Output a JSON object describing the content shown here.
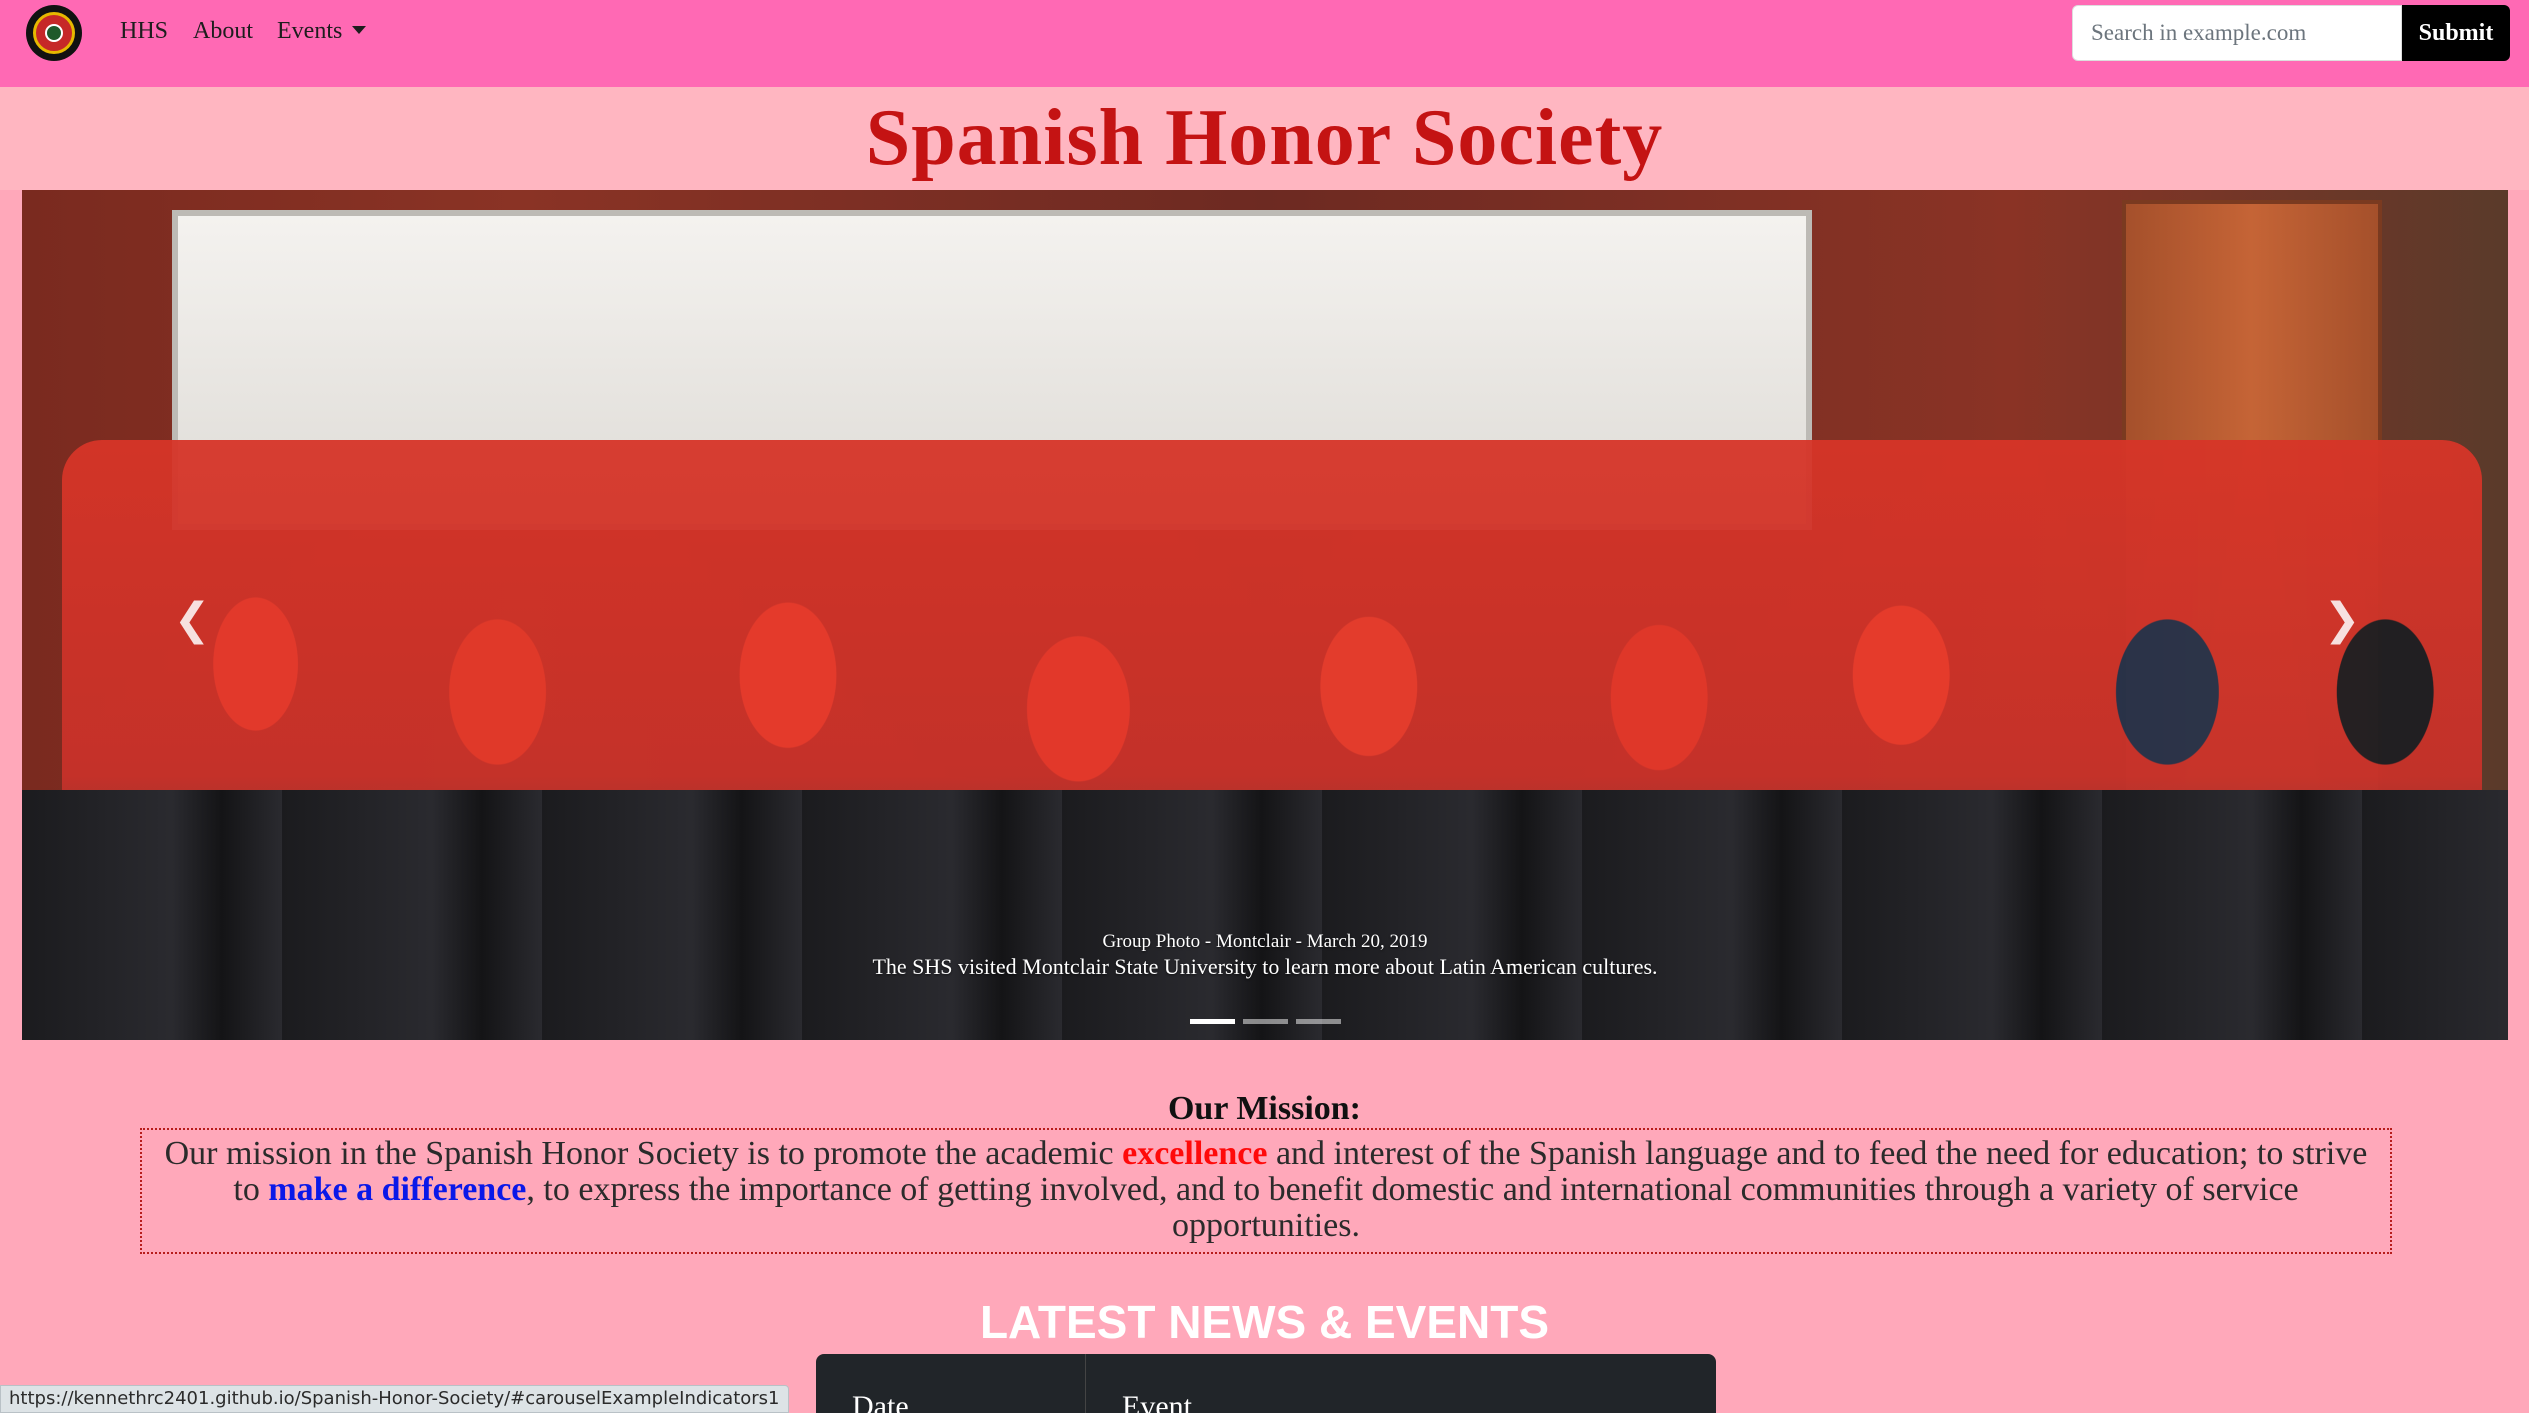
{
  "navbar": {
    "brand": "HHS",
    "about": "About",
    "events": "Events",
    "logo_icon": "school-crest-icon"
  },
  "search": {
    "placeholder": "Search in example.com",
    "submit_label": "Submit"
  },
  "header": {
    "title": "Spanish Honor Society"
  },
  "carousel": {
    "caption_title": "Group Photo - Montclair - March 20, 2019",
    "caption_text": "The SHS visited Montclair State University to learn more about Latin American cultures.",
    "prev_icon": "chevron-left-icon",
    "next_icon": "chevron-right-icon",
    "indicators": 3,
    "active_indicator": 0
  },
  "mission": {
    "heading": "Our Mission:",
    "text_1": "Our mission in the Spanish Honor Society is to promote the academic ",
    "highlight_1": "excellence",
    "text_2": " and interest of the Spanish language and to feed the need for education; to strive to ",
    "highlight_2": "make a difference",
    "text_3": ", to express the importance of getting involved, and to benefit domestic and international communities through a variety of service opportunities."
  },
  "news": {
    "heading": "LATEST NEWS & EVENTS",
    "columns": [
      "Date",
      "Event"
    ]
  },
  "status_bar": {
    "url": "https://kennethrc2401.github.io/Spanish-Honor-Society/#carouselExampleIndicators1"
  },
  "colors": {
    "navbar": "#ff69b4",
    "page_background": "#ffa8ba",
    "title": "#c41313",
    "highlight_red": "#ff0a0a",
    "highlight_blue": "#0a18e8"
  }
}
